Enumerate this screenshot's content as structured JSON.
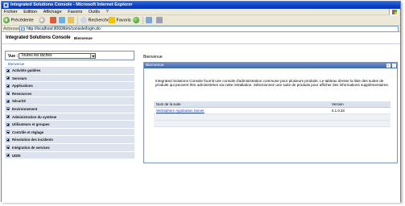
{
  "window": {
    "title": "Integrated Solutions Console - Microsoft Internet Explorer"
  },
  "menubar": {
    "items": [
      "Fichier",
      "Edition",
      "Affichage",
      "Favoris",
      "Outils",
      "?"
    ]
  },
  "toolbar": {
    "back_label": "Précédente",
    "search_label": "Rechercher",
    "favorites_label": "Favoris"
  },
  "address": {
    "label": "Adresse",
    "url": "http://localhost:9060/ibm/console/login.do"
  },
  "banner": {
    "product": "Integrated Solutions Console",
    "welcome": "Bienvenue"
  },
  "nav": {
    "view_label": "Vue :",
    "view_value": "Toutes les tâches",
    "items": [
      "Bienvenue",
      "Activités guidées",
      "Serveurs",
      "Applications",
      "Ressources",
      "Sécurité",
      "Environnement",
      "Administration du système",
      "Utilisateurs et groupes",
      "Contrôle et réglage",
      "Résolution des incidents",
      "Intégration de services",
      "UDDI"
    ]
  },
  "main": {
    "crumb": "Bienvenue",
    "portlet_title": "Bienvenue",
    "portlet_icons": [
      "?",
      "-"
    ],
    "intro": "Integrated Solutions Console fournit une console d'administration commune pour plusieurs produits. Le tableau dresse la liste des suites de produits qui peuvent être administrées via cette installation. Sélectionnez une suite de produits pour afficher des informations supplémentaires.",
    "table": {
      "col_suite": "Nom de la suite",
      "col_version": "Version",
      "rows": [
        {
          "suite": "WebSphere Application Server",
          "version": "6.1.0.33"
        }
      ]
    }
  }
}
